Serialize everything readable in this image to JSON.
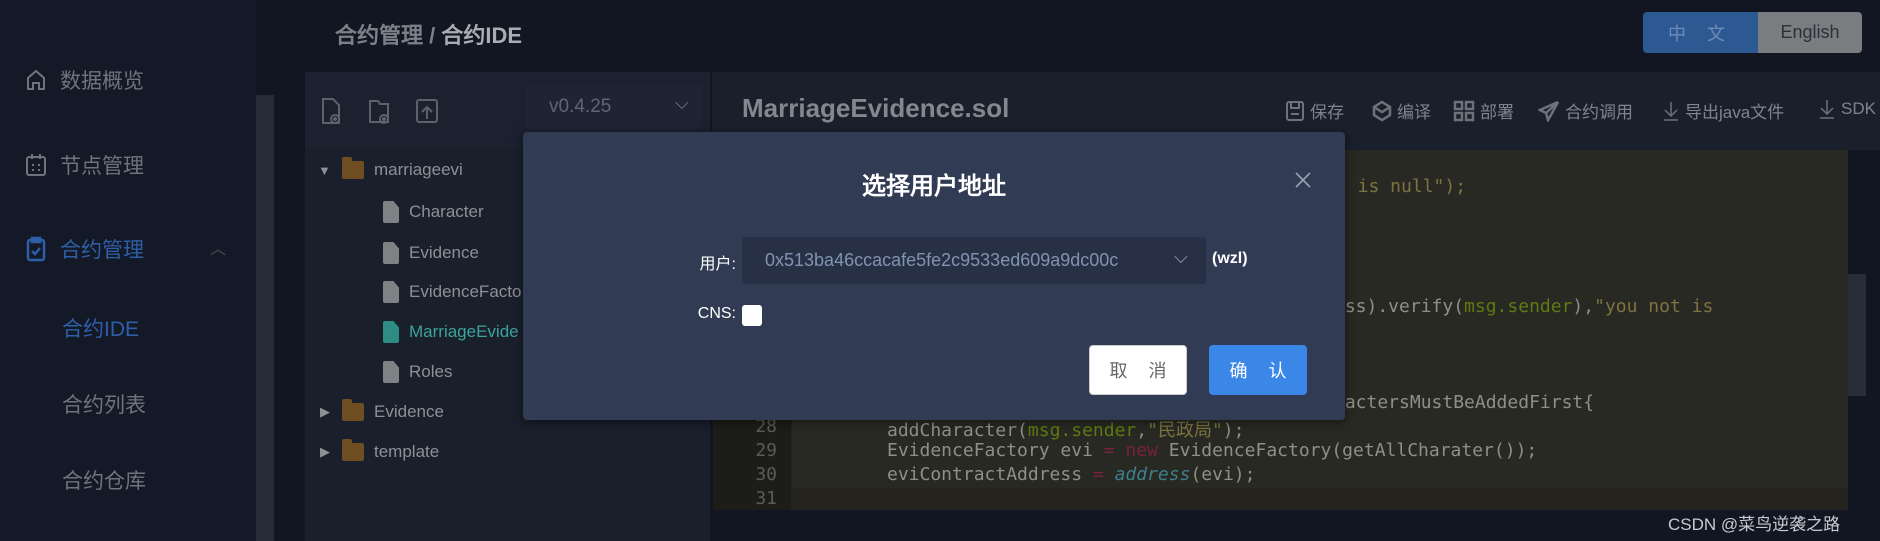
{
  "sidebar": {
    "items": [
      {
        "label": "数据概览",
        "icon": "home-icon"
      },
      {
        "label": "节点管理",
        "icon": "calendar-icon"
      },
      {
        "label": "合约管理",
        "icon": "clipboard-check-icon",
        "active": true,
        "expanded": true
      },
      {
        "label": "合约IDE",
        "active": true
      },
      {
        "label": "合约列表"
      },
      {
        "label": "合约仓库"
      }
    ]
  },
  "breadcrumb": {
    "parent": "合约管理",
    "separator": "/",
    "current": "合约IDE"
  },
  "language": {
    "zh": "中 文",
    "en": "English",
    "selected": "中 文"
  },
  "file_panel": {
    "version": "v0.4.25",
    "tree": [
      {
        "label": "marriageevi",
        "type": "folder",
        "expanded": true
      },
      {
        "label": "Character",
        "type": "file"
      },
      {
        "label": "Evidence",
        "type": "file"
      },
      {
        "label": "EvidenceFacto",
        "type": "file"
      },
      {
        "label": "MarriageEvide",
        "type": "file",
        "selected": true
      },
      {
        "label": "Roles",
        "type": "file"
      },
      {
        "label": "Evidence",
        "type": "folder",
        "expanded": false
      },
      {
        "label": "template",
        "type": "folder",
        "expanded": false
      }
    ]
  },
  "editor": {
    "title": "MarriageEvidence.sol",
    "toolbar": {
      "save": "保存",
      "compile": "编译",
      "deploy": "部署",
      "call": "合约调用",
      "export": "导出java文件",
      "sdk": "SDK"
    },
    "line_numbers": [
      "28",
      "29",
      "30",
      "31"
    ],
    "fragments": {
      "l18": "t is null\");",
      "l23a": "ess).verify(",
      "l23b": "msg.sender",
      "l23c": "),",
      "l23d": "\"you not is",
      "l27": "ractersMustBeAddedFirst{"
    },
    "lines": {
      "l28": {
        "a": "addCharacter(",
        "b": "msg.sender",
        ",": ",",
        "c": "\"民政局\"",
        "d": ");"
      },
      "l29": {
        "a": "EvidenceFactory evi ",
        "op": "=",
        "kw": " new",
        "b": " EvidenceFactory(getAllCharater());"
      },
      "l30": {
        "a": "eviContractAddress ",
        "op": "=",
        "ty": " address",
        "b": "(evi);"
      }
    }
  },
  "modal": {
    "title": "选择用户地址",
    "user_label": "用户:",
    "user_value": "0x513ba46ccacafe5fe2c9533ed609a9dc00c",
    "user_name": "(wzl)",
    "cns_label": "CNS:",
    "cns_checked": false,
    "cancel": "取 消",
    "confirm": "确 认"
  },
  "watermark": "CSDN @菜鸟逆袭之路",
  "colors": {
    "accent": "#3a87e8",
    "active_nav": "#2f5ea8",
    "selected_file": "#3aa39a"
  }
}
